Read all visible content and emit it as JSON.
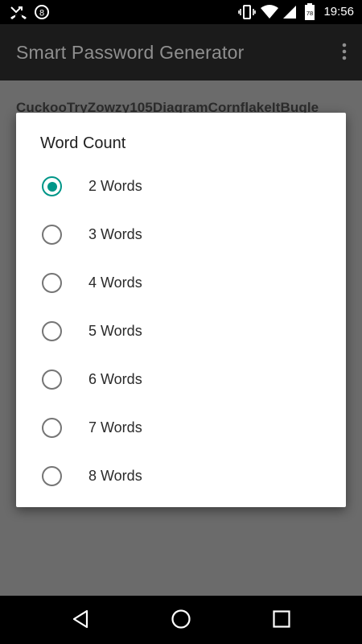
{
  "status_bar": {
    "time": "19:56",
    "battery_level": "78",
    "icons": [
      "missed-call-icon",
      "circle-badge-icon",
      "vibrate-icon",
      "wifi-icon",
      "signal-icon",
      "battery-icon"
    ]
  },
  "app_bar": {
    "title": "Smart Password Generator",
    "menu_icon": "more-vert-icon"
  },
  "content": {
    "generated_password": "CuckooTryZowzy105DiagramCornflakeItBugle"
  },
  "dialog": {
    "title": "Word Count",
    "selected_index": 0,
    "options": [
      {
        "label": "2 Words"
      },
      {
        "label": "3 Words"
      },
      {
        "label": "4 Words"
      },
      {
        "label": "5 Words"
      },
      {
        "label": "6 Words"
      },
      {
        "label": "7 Words"
      },
      {
        "label": "8 Words"
      }
    ]
  },
  "colors": {
    "accent": "#009688",
    "scrim": "#6b6b6b",
    "app_bar": "#1b1b1b"
  },
  "nav_bar": {
    "icons": [
      "back-icon",
      "home-icon",
      "recents-icon"
    ]
  }
}
